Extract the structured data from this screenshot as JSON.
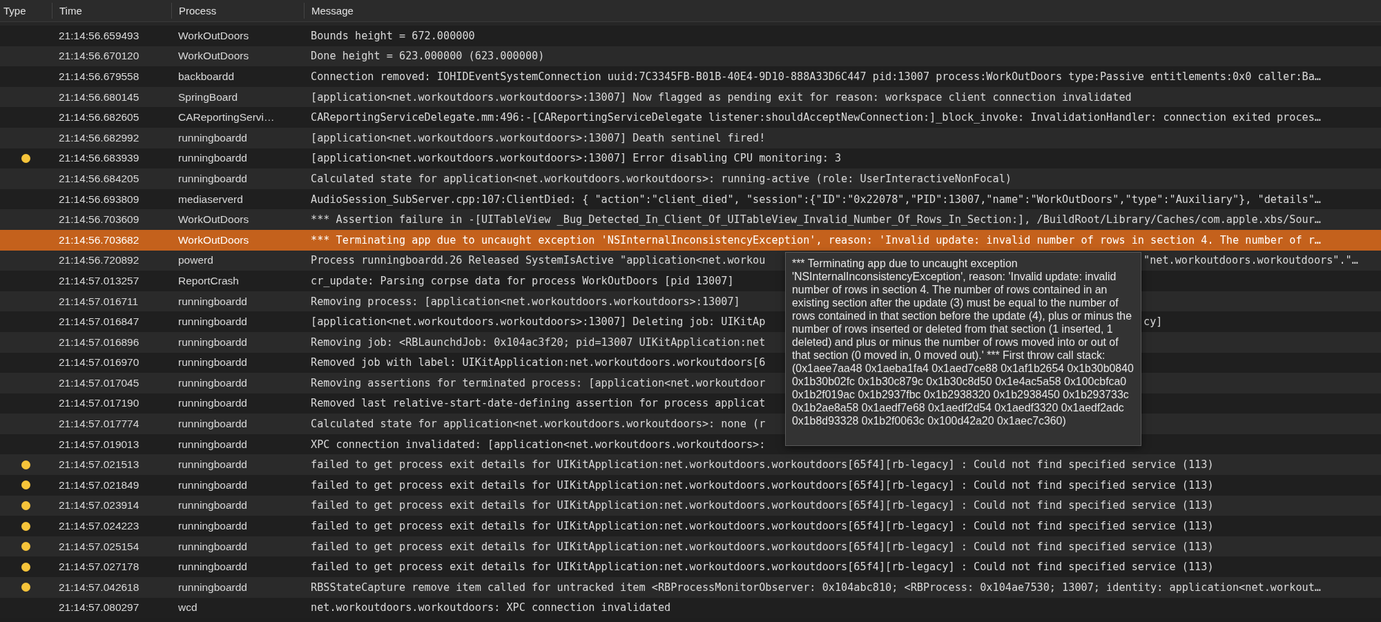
{
  "columns": [
    "Type",
    "Time",
    "Process",
    "Message"
  ],
  "rows": [
    {
      "kind": "default",
      "selected": false,
      "time": "21:14:56.659493",
      "process": "WorkOutDoors",
      "message": "Bounds height = 672.000000"
    },
    {
      "kind": "default",
      "selected": false,
      "time": "21:14:56.670120",
      "process": "WorkOutDoors",
      "message": "Done height = 623.000000 (623.000000)"
    },
    {
      "kind": "default",
      "selected": false,
      "time": "21:14:56.679558",
      "process": "backboardd",
      "message": "Connection removed: IOHIDEventSystemConnection uuid:7C3345FB-B01B-40E4-9D10-888A33D6C447 pid:13007 process:WorkOutDoors type:Passive entitlements:0x0 caller:Ba…"
    },
    {
      "kind": "default",
      "selected": false,
      "time": "21:14:56.680145",
      "process": "SpringBoard",
      "message": "[application<net.workoutdoors.workoutdoors>:13007] Now flagged as pending exit for reason: workspace client connection invalidated"
    },
    {
      "kind": "default",
      "selected": false,
      "time": "21:14:56.682605",
      "process": "CAReportingServi…",
      "message": "CAReportingServiceDelegate.mm:496:-[CAReportingServiceDelegate listener:shouldAcceptNewConnection:]_block_invoke: InvalidationHandler: connection exited proces…"
    },
    {
      "kind": "default",
      "selected": false,
      "time": "21:14:56.682992",
      "process": "runningboardd",
      "message": "[application<net.workoutdoors.workoutdoors>:13007] Death sentinel fired!"
    },
    {
      "kind": "error",
      "selected": false,
      "time": "21:14:56.683939",
      "process": "runningboardd",
      "message": "[application<net.workoutdoors.workoutdoors>:13007] Error disabling CPU monitoring: 3"
    },
    {
      "kind": "default",
      "selected": false,
      "time": "21:14:56.684205",
      "process": "runningboardd",
      "message": "Calculated state for application<net.workoutdoors.workoutdoors>: running-active (role: UserInteractiveNonFocal)"
    },
    {
      "kind": "default",
      "selected": false,
      "time": "21:14:56.693809",
      "process": "mediaserverd",
      "message": "AudioSession_SubServer.cpp:107:ClientDied: { \"action\":\"client_died\", \"session\":{\"ID\":\"0x22078\",\"PID\":13007,\"name\":\"WorkOutDoors\",\"type\":\"Auxiliary\"}, \"details\"…"
    },
    {
      "kind": "default",
      "selected": false,
      "time": "21:14:56.703609",
      "process": "WorkOutDoors",
      "message": "*** Assertion failure in -[UITableView _Bug_Detected_In_Client_Of_UITableView_Invalid_Number_Of_Rows_In_Section:], /BuildRoot/Library/Caches/com.apple.xbs/Sour…"
    },
    {
      "kind": "default",
      "selected": true,
      "time": "21:14:56.703682",
      "process": "WorkOutDoors",
      "message": "*** Terminating app due to uncaught exception 'NSInternalInconsistencyException', reason: 'Invalid update: invalid number of rows in section 4. The number of r…"
    },
    {
      "kind": "default",
      "selected": false,
      "time": "21:14:56.720892",
      "process": "powerd",
      "message": "Process runningboardd.26 Released SystemIsActive \"application<net.workou",
      "message_tail": "\"net.workoutdoors.workoutdoors\".\"…"
    },
    {
      "kind": "default",
      "selected": false,
      "time": "21:14:57.013257",
      "process": "ReportCrash",
      "message": "cr_update: Parsing corpse data for process WorkOutDoors [pid 13007]"
    },
    {
      "kind": "default",
      "selected": false,
      "time": "21:14:57.016711",
      "process": "runningboardd",
      "message": "Removing process: [application<net.workoutdoors.workoutdoors>:13007]"
    },
    {
      "kind": "default",
      "selected": false,
      "time": "21:14:57.016847",
      "process": "runningboardd",
      "message": "[application<net.workoutdoors.workoutdoors>:13007] Deleting job: UIKitAp",
      "message_tail": "cy]"
    },
    {
      "kind": "default",
      "selected": false,
      "time": "21:14:57.016896",
      "process": "runningboardd",
      "message": "Removing job: <RBLaunchdJob: 0x104ac3f20; pid=13007 UIKitApplication:net"
    },
    {
      "kind": "default",
      "selected": false,
      "time": "21:14:57.016970",
      "process": "runningboardd",
      "message": "Removed job with label: UIKitApplication:net.workoutdoors.workoutdoors[6"
    },
    {
      "kind": "default",
      "selected": false,
      "time": "21:14:57.017045",
      "process": "runningboardd",
      "message": "Removing assertions for terminated process: [application<net.workoutdoor"
    },
    {
      "kind": "default",
      "selected": false,
      "time": "21:14:57.017190",
      "process": "runningboardd",
      "message": "Removed last relative-start-date-defining assertion for process applicat"
    },
    {
      "kind": "default",
      "selected": false,
      "time": "21:14:57.017774",
      "process": "runningboardd",
      "message": "Calculated state for application<net.workoutdoors.workoutdoors>: none (r"
    },
    {
      "kind": "default",
      "selected": false,
      "time": "21:14:57.019013",
      "process": "runningboardd",
      "message": "XPC connection invalidated: [application<net.workoutdoors.workoutdoors>:"
    },
    {
      "kind": "error",
      "selected": false,
      "time": "21:14:57.021513",
      "process": "runningboardd",
      "message": "failed to get process exit details for UIKitApplication:net.workoutdoors.workoutdoors[65f4][rb-legacy] : Could not find specified service (113)"
    },
    {
      "kind": "error",
      "selected": false,
      "time": "21:14:57.021849",
      "process": "runningboardd",
      "message": "failed to get process exit details for UIKitApplication:net.workoutdoors.workoutdoors[65f4][rb-legacy] : Could not find specified service (113)"
    },
    {
      "kind": "error",
      "selected": false,
      "time": "21:14:57.023914",
      "process": "runningboardd",
      "message": "failed to get process exit details for UIKitApplication:net.workoutdoors.workoutdoors[65f4][rb-legacy] : Could not find specified service (113)"
    },
    {
      "kind": "error",
      "selected": false,
      "time": "21:14:57.024223",
      "process": "runningboardd",
      "message": "failed to get process exit details for UIKitApplication:net.workoutdoors.workoutdoors[65f4][rb-legacy] : Could not find specified service (113)"
    },
    {
      "kind": "error",
      "selected": false,
      "time": "21:14:57.025154",
      "process": "runningboardd",
      "message": "failed to get process exit details for UIKitApplication:net.workoutdoors.workoutdoors[65f4][rb-legacy] : Could not find specified service (113)"
    },
    {
      "kind": "error",
      "selected": false,
      "time": "21:14:57.027178",
      "process": "runningboardd",
      "message": "failed to get process exit details for UIKitApplication:net.workoutdoors.workoutdoors[65f4][rb-legacy] : Could not find specified service (113)"
    },
    {
      "kind": "error",
      "selected": false,
      "time": "21:14:57.042618",
      "process": "runningboardd",
      "message": "RBSStateCapture remove item called for untracked item <RBProcessMonitorObserver: 0x104abc810; <RBProcess: 0x104ae7530; 13007; identity: application<net.workout…"
    },
    {
      "kind": "default",
      "selected": false,
      "time": "21:14:57.080297",
      "process": "wcd",
      "message": "net.workoutdoors.workoutdoors: XPC connection invalidated"
    }
  ],
  "tooltip": {
    "text": "*** Terminating app due to uncaught exception 'NSInternalInconsistencyException', reason: 'Invalid update: invalid number of rows in section 4. The number of rows contained in an existing section after the update (3) must be equal to the number of rows contained in that section before the update (4), plus or minus the number of rows inserted or deleted from that section (1 inserted, 1 deleted) and plus or minus the number of rows moved into or out of that section (0 moved in, 0 moved out).' *** First throw call stack: (0x1aee7aa48 0x1aeba1fa4 0x1aed7ce88 0x1af1b2654 0x1b30b0840 0x1b30b02fc 0x1b30c879c 0x1b30c8d50 0x1e4ac5a58 0x100cbfca0 0x1b2f019ac 0x1b2937fbc 0x1b2938320 0x1b2938450 0x1b293733c 0x1b2ae8a58 0x1aedf7e68 0x1aedf2d54 0x1aedf3320 0x1aedf2adc 0x1b8d93328 0x1b2f0063c 0x100d42a20 0x1aec7c360)"
  }
}
